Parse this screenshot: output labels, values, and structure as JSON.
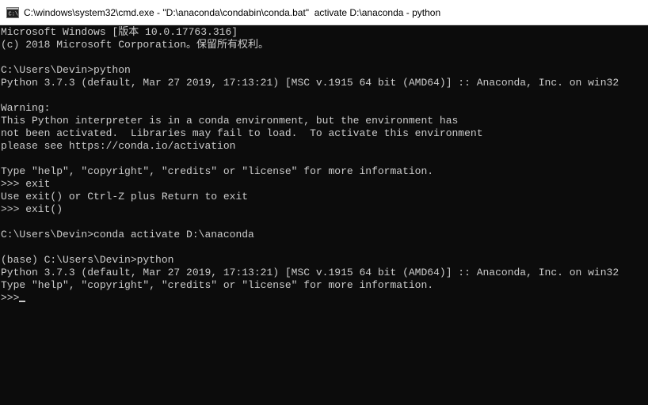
{
  "window": {
    "title": "C:\\windows\\system32\\cmd.exe - \"D:\\anaconda\\condabin\\conda.bat\"  activate D:\\anaconda - python",
    "icon": "cmd-icon"
  },
  "console": {
    "lines": [
      "Microsoft Windows [版本 10.0.17763.316]",
      "(c) 2018 Microsoft Corporation。保留所有权利。",
      "",
      "C:\\Users\\Devin>python",
      "Python 3.7.3 (default, Mar 27 2019, 17:13:21) [MSC v.1915 64 bit (AMD64)] :: Anaconda, Inc. on win32",
      "",
      "Warning:",
      "This Python interpreter is in a conda environment, but the environment has",
      "not been activated.  Libraries may fail to load.  To activate this environment",
      "please see https://conda.io/activation",
      "",
      "Type \"help\", \"copyright\", \"credits\" or \"license\" for more information.",
      ">>> exit",
      "Use exit() or Ctrl-Z plus Return to exit",
      ">>> exit()",
      "",
      "C:\\Users\\Devin>conda activate D:\\anaconda",
      "",
      "(base) C:\\Users\\Devin>python",
      "Python 3.7.3 (default, Mar 27 2019, 17:13:21) [MSC v.1915 64 bit (AMD64)] :: Anaconda, Inc. on win32",
      "Type \"help\", \"copyright\", \"credits\" or \"license\" for more information.",
      ">>>"
    ]
  },
  "colors": {
    "background": "#0c0c0c",
    "text": "#cccccc",
    "titlebar": "#ffffff"
  }
}
